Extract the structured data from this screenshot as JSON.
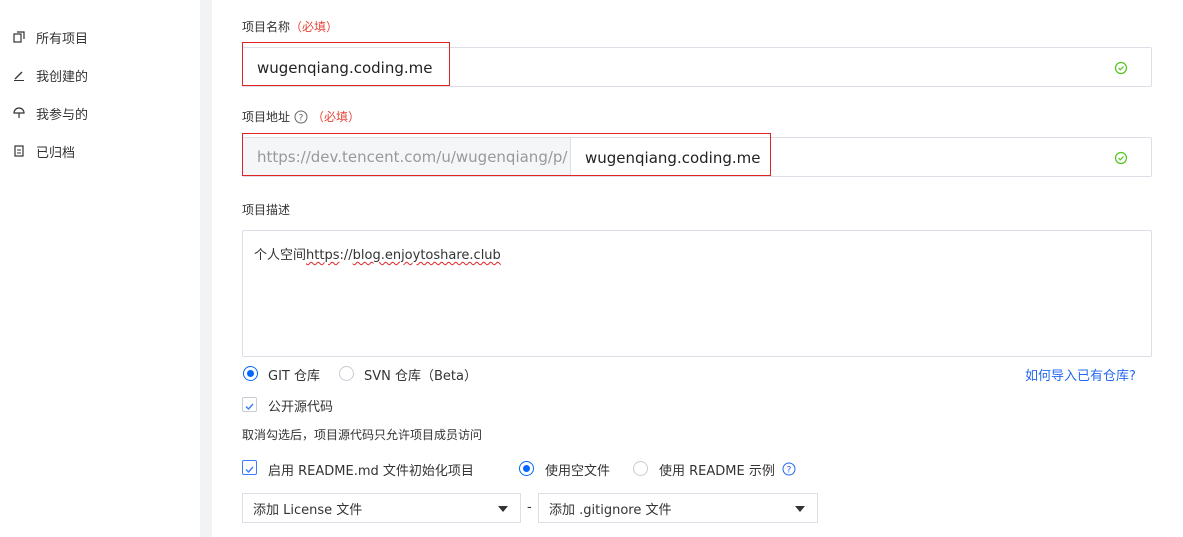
{
  "sidebar": {
    "items": [
      {
        "label": "所有项目",
        "icon": "copy-icon"
      },
      {
        "label": "我创建的",
        "icon": "pen-icon"
      },
      {
        "label": "我参与的",
        "icon": "umbrella-icon"
      },
      {
        "label": "已归档",
        "icon": "archive-icon"
      }
    ]
  },
  "form": {
    "name_label": "项目名称",
    "required_tag": "（必填）",
    "name_value": "wugenqiang.coding.me",
    "addr_label": "项目地址",
    "addr_prefix": "https://dev.tencent.com/u/wugenqiang/p/",
    "addr_value": "wugenqiang.coding.me",
    "desc_label": "项目描述",
    "desc_prefix": "个人空间",
    "desc_link_part1": "https",
    "desc_link_part2": "://",
    "desc_link_part3": "blog.enjoytoshare.club",
    "repo_git_label": "GIT 仓库",
    "repo_svn_label": "SVN 仓库（Beta）",
    "import_link": "如何导入已有仓库?",
    "public_label": "公开源代码",
    "public_hint": "取消勾选后，项目源代码只允许项目成员访问",
    "readme_label": "启用 README.md 文件初始化项目",
    "empty_file_label": "使用空文件",
    "readme_example_label": "使用 README 示例",
    "license_select": "添加 License 文件",
    "separator": "-",
    "gitignore_select": "添加 .gitignore 文件"
  },
  "colors": {
    "accent": "#0066ff",
    "ok": "#52c41a",
    "required": "#e5473b",
    "highlight": "#e02424"
  }
}
